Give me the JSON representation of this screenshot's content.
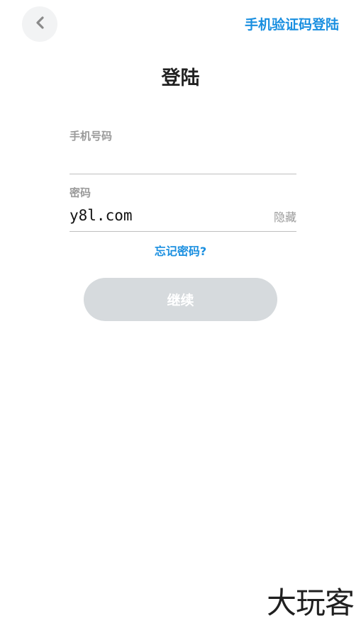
{
  "header": {
    "back_icon": "chevron-left-icon",
    "sms_login_label": "手机验证码登陆"
  },
  "page": {
    "title": "登陆"
  },
  "form": {
    "phone": {
      "label": "手机号码",
      "value": ""
    },
    "password": {
      "label": "密码",
      "value": "y8l.com",
      "toggle_label": "隐藏"
    },
    "forgot_label": "忘记密码?",
    "continue_label": "继续"
  },
  "watermark": "大玩客",
  "colors": {
    "accent": "#1a8fe0",
    "button_disabled": "#d6dadd",
    "label_gray": "#9a9a9a"
  }
}
